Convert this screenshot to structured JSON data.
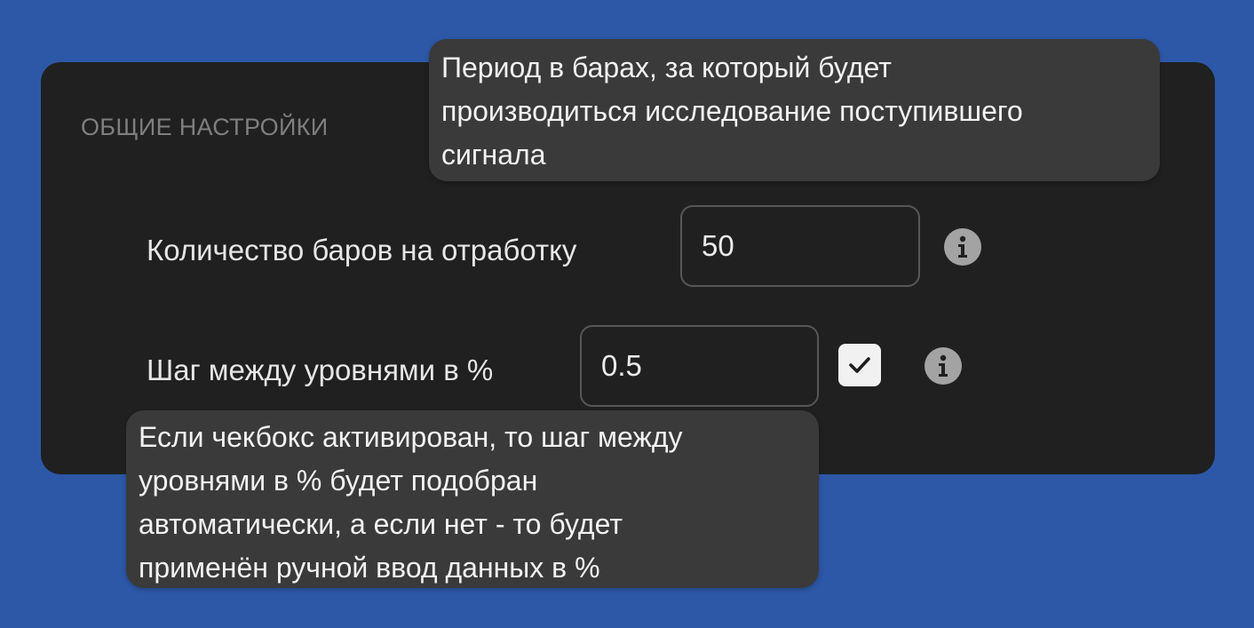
{
  "colors": {
    "background": "#2d58a8",
    "panel": "#202020",
    "tooltip": "#3a3a3a",
    "field_border": "#575757",
    "info_icon": "#a3a3a3"
  },
  "section": {
    "title": "ОБЩИЕ НАСТРОЙКИ"
  },
  "fields": {
    "bars_count": {
      "label": "Количество баров на отработку",
      "value": "50",
      "info_icon": "info-icon"
    },
    "level_step": {
      "label": "Шаг между уровнями в %",
      "value": "0.5",
      "auto_checkbox_checked": true,
      "info_icon": "info-icon"
    }
  },
  "tooltips": {
    "bars_count": [
      "Период в барах, за который будет",
      "производиться исследование поступившего",
      "сигнала"
    ],
    "auto_step": [
      "Если чекбокс активирован, то шаг между",
      "уровнями в % будет подобран",
      "автоматически, а если нет - то будет",
      "применён ручной ввод данных в %"
    ]
  }
}
